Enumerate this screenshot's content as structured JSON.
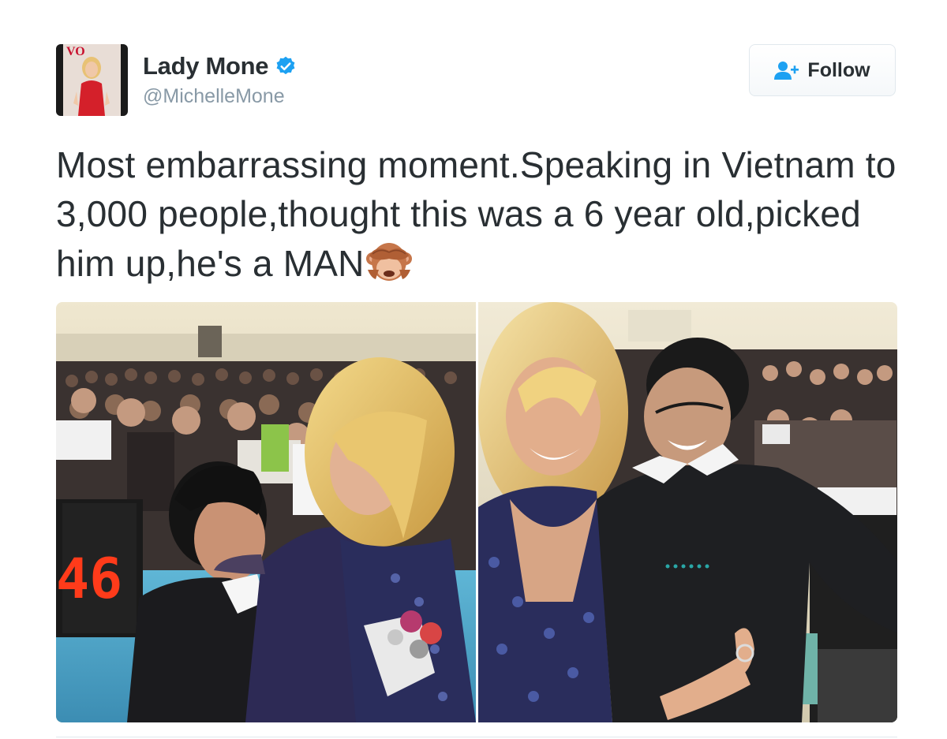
{
  "user": {
    "display_name": "Lady Mone",
    "handle": "@MichelleMone",
    "verified": true,
    "avatar_magazine_text": "VO"
  },
  "follow_button": {
    "label": "Follow",
    "icon": "follow-user-icon"
  },
  "tweet": {
    "text": "Most embarrassing moment.Speaking in Vietnam to 3,000 people,thought this was a 6 year old,picked him up,he's a MAN",
    "emoji": "see-no-evil-monkey-icon"
  },
  "media": {
    "photos": [
      {
        "scoreboard_text": "46",
        "icon": "photo-icon"
      },
      {
        "icon": "photo-icon"
      }
    ]
  },
  "colors": {
    "text": "#292f33",
    "secondary_text": "#8899a6",
    "verified_blue": "#1da1f2",
    "border": "#e1e8ed"
  }
}
